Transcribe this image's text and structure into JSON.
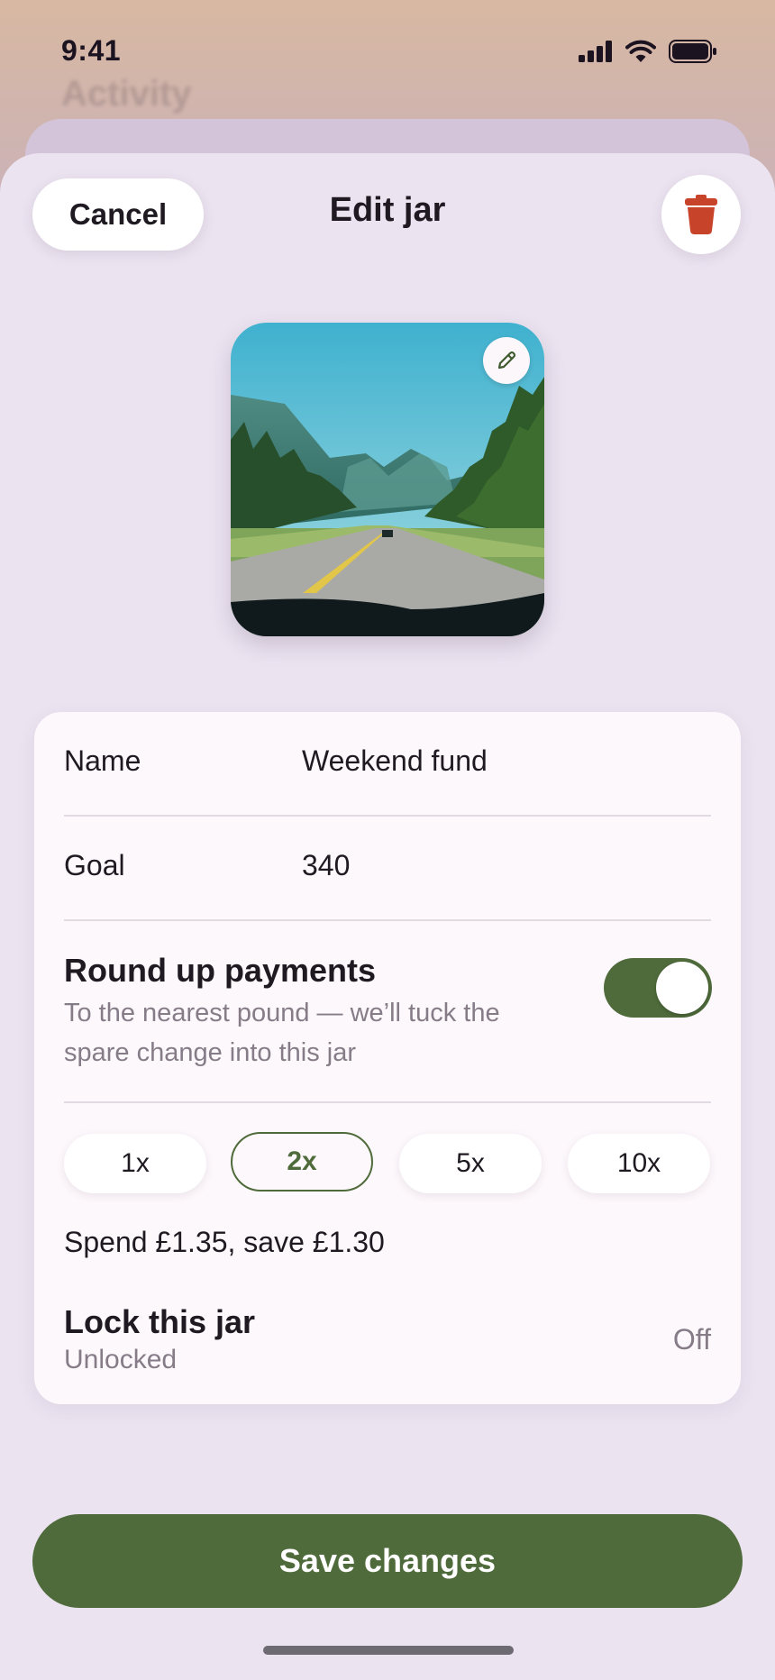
{
  "status_bar": {
    "time": "9:41"
  },
  "background": {
    "title": "Activity"
  },
  "sheet": {
    "cancel_label": "Cancel",
    "title": "Edit jar",
    "delete_icon": "trash-icon"
  },
  "photo": {
    "edit_icon": "pencil-icon",
    "description": "road through forest toward mountains"
  },
  "form": {
    "name_label": "Name",
    "name_value": "Weekend fund",
    "goal_label": "Goal",
    "goal_value": "340",
    "round_up_title": "Round up payments",
    "round_up_description": "To the nearest pound — we’ll tuck the spare change into this jar",
    "round_up_enabled": true,
    "multipliers": [
      "1x",
      "2x",
      "5x",
      "10x"
    ],
    "selected_multiplier": "2x",
    "spend_save_text": "Spend £1.35, save £1.30",
    "lock_title": "Lock this jar",
    "lock_subtitle": "Unlocked",
    "lock_status": "Off"
  },
  "actions": {
    "save_label": "Save changes"
  },
  "colors": {
    "accent_green": "#4f6b3b",
    "delete_red": "#c7432a",
    "sheet_bg": "#ebe3f0",
    "card_bg": "#fdf8fc"
  }
}
